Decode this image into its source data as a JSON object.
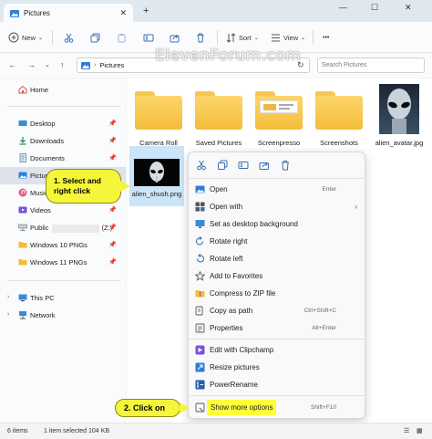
{
  "window": {
    "tab_title": "Pictures",
    "tab_close": "✕",
    "tab_add": "+",
    "minimize": "—",
    "maximize": "☐",
    "close": "✕"
  },
  "toolbar": {
    "new_label": "New",
    "sort_label": "Sort",
    "view_label": "View",
    "more_label": "•••"
  },
  "address": {
    "path": "Pictures",
    "search_placeholder": "Search Pictures"
  },
  "watermark": "ElevenForum.com",
  "sidebar": {
    "items": [
      {
        "label": "Home"
      },
      {
        "label": "Desktop",
        "pinned": true
      },
      {
        "label": "Downloads",
        "pinned": true
      },
      {
        "label": "Documents",
        "pinned": true
      },
      {
        "label": "Pictures",
        "pinned": true
      },
      {
        "label": "Music",
        "pinned": true
      },
      {
        "label": "Videos",
        "pinned": true
      },
      {
        "label": "Public",
        "drive": "(Z:)",
        "pinned": true
      },
      {
        "label": "Windows 10 PNGs",
        "pinned": true
      },
      {
        "label": "Windows 11 PNGs",
        "pinned": true
      },
      {
        "label": "This PC"
      },
      {
        "label": "Network"
      }
    ]
  },
  "files": [
    {
      "name": "Camera Roll",
      "type": "folder"
    },
    {
      "name": "Saved Pictures",
      "type": "folder"
    },
    {
      "name": "Screenpresso",
      "type": "folder"
    },
    {
      "name": "Screenshots",
      "type": "folder"
    },
    {
      "name": "alien_avatar.jpg",
      "type": "image"
    },
    {
      "name": "alien_shush.png",
      "type": "image",
      "selected": true
    }
  ],
  "context_menu": {
    "items": [
      {
        "label": "Open",
        "shortcut": "Enter"
      },
      {
        "label": "Open with",
        "submenu": "›"
      },
      {
        "label": "Set as desktop background"
      },
      {
        "label": "Rotate right"
      },
      {
        "label": "Rotate left"
      },
      {
        "label": "Add to Favorites"
      },
      {
        "label": "Compress to ZIP file"
      },
      {
        "label": "Copy as path",
        "shortcut": "Ctrl+Shift+C"
      },
      {
        "label": "Properties",
        "shortcut": "Alt+Enter"
      },
      {
        "label": "Edit with Clipchamp"
      },
      {
        "label": "Resize pictures"
      },
      {
        "label": "PowerRename"
      },
      {
        "label": "Show more options",
        "shortcut": "Shift+F10"
      }
    ]
  },
  "callouts": {
    "step1": "1. Select and right click",
    "step2": "2. Click on"
  },
  "status": {
    "item_count": "6 items",
    "selection": "1 item selected  104 KB"
  },
  "colors": {
    "accent": "#0067c0",
    "callout": "#f5f53a",
    "folder": "#f6c84f",
    "selection": "#cce4f7"
  }
}
